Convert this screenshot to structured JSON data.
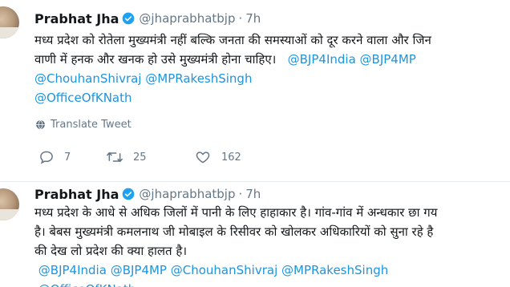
{
  "tweets": [
    {
      "author_name": "Prabhat Jha",
      "handle": "@jhaprabhatbjp",
      "separator": "·",
      "time": "7h",
      "lines": [
        [
          {
            "t": "मध्य प्रदेश को रोतेला मुख्यमंत्री नहीं बल्कि जनता की समस्याओं को दूर करने वाला और जिन"
          }
        ],
        [
          {
            "t": "वाणी में हनक और खनक हो उसे मुख्यमंत्री होना चाहिए।   "
          },
          {
            "t": "@BJP4India",
            "m": true
          },
          {
            "t": " "
          },
          {
            "t": "@BJP4MP",
            "m": true
          }
        ],
        [
          {
            "t": "@ChouhanShivraj",
            "m": true
          },
          {
            "t": " "
          },
          {
            "t": "@MPRakeshSingh",
            "m": true
          }
        ],
        [
          {
            "t": "@OfficeOfKNath",
            "m": true
          }
        ]
      ],
      "translate_label": "Translate Tweet",
      "replies": "7",
      "retweets": "25",
      "likes": "162"
    },
    {
      "author_name": "Prabhat Jha",
      "handle": "@jhaprabhatbjp",
      "separator": "·",
      "time": "7h",
      "lines": [
        [
          {
            "t": "मध्य प्रदेश के आधे से अधिक जिलों में पानी के लिए हाहाकार है। गांव-गांव में अन्धकार छा गय"
          }
        ],
        [
          {
            "t": "है। बेबस मुख्यमंत्री कमलनाथ जी मोबाइल के रिसीवर को खोलकर अधिकारियों को सुना रहे है"
          }
        ],
        [
          {
            "t": "की देख लो प्रदेश की क्या हालत है।"
          }
        ],
        [
          {
            "t": " "
          },
          {
            "t": "@BJP4India",
            "m": true
          },
          {
            "t": " "
          },
          {
            "t": "@BJP4MP",
            "m": true
          },
          {
            "t": " "
          },
          {
            "t": "@ChouhanShivraj",
            "m": true
          },
          {
            "t": " "
          },
          {
            "t": "@MPRakeshSingh",
            "m": true
          }
        ],
        [
          {
            "t": " "
          },
          {
            "t": "@OfficeOfKNath",
            "m": true
          }
        ]
      ]
    }
  ],
  "colors": {
    "accent": "#1b95e0",
    "verified": "#1da1f2",
    "text": "#14171a",
    "muted": "#657786",
    "divider": "#e6ecf0"
  },
  "icons": {
    "verified": "verified-badge-icon",
    "translate": "globe-icon",
    "reply": "reply-icon",
    "retweet": "retweet-icon",
    "like": "heart-icon"
  }
}
